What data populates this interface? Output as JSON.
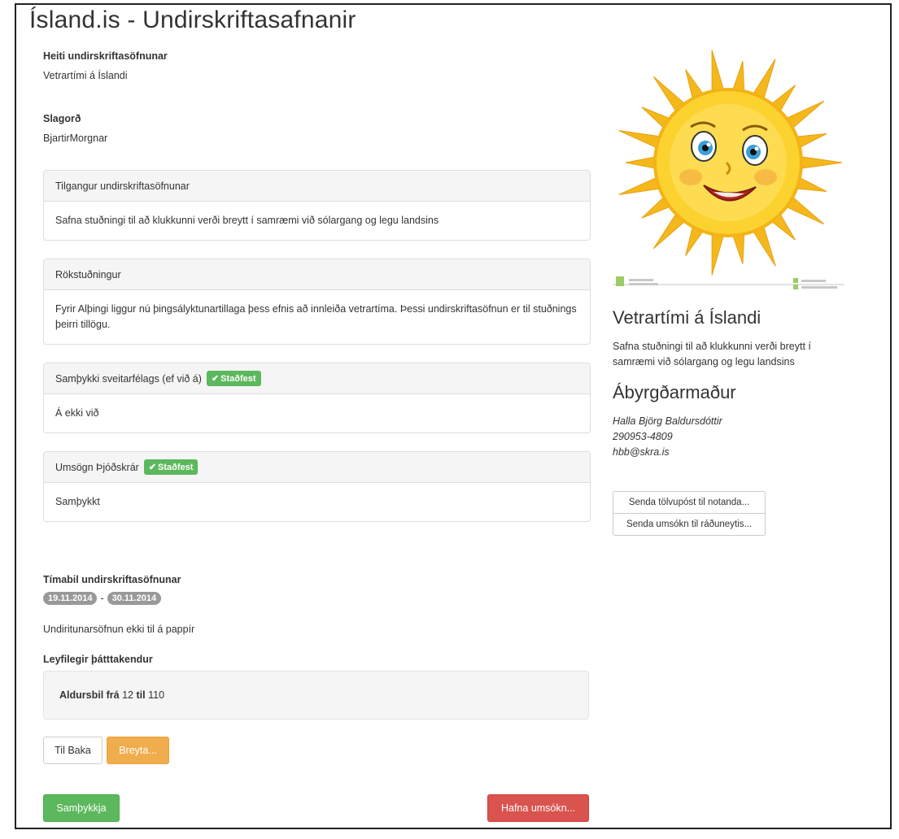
{
  "page": {
    "title": "Ísland.is - Undirskriftasafnanir"
  },
  "petition": {
    "name_label": "Heiti undirskriftasöfnunar",
    "name_value": "Vetrartími á Íslandi",
    "slogan_label": "Slagorð",
    "slogan_value": "BjartirMorgnar"
  },
  "panels": {
    "purpose": {
      "heading": "Tilgangur undirskriftasöfnunar",
      "body": "Safna stuðningi til að klukkunni verði breytt í samræmi við sólargang og legu landsins"
    },
    "reasoning": {
      "heading": "Rökstuðningur",
      "body": "Fyrir Alþingi liggur nú þingsályktunartillaga þess efnis að innleiða vetrartíma. Þessi undirskriftasöfnun er til stuðnings þeirri tillögu."
    },
    "municipality": {
      "heading": "Samþykki sveitarfélags (ef við á)",
      "badge": "Staðfest",
      "body": "Á ekki við"
    },
    "registry": {
      "heading": "Umsögn Þjóðskrár",
      "badge": "Staðfest",
      "body": "Samþykkt"
    }
  },
  "period": {
    "label": "Tímabil undirskriftasöfnunar",
    "start": "19.11.2014",
    "separator": "-",
    "end": "30.11.2014",
    "paper_note": "Undiritunarsöfnun ekki til á pappír"
  },
  "participants": {
    "label": "Leyfilegir þátttakendur",
    "age_prefix": "Aldursbil frá",
    "age_from": "12",
    "age_mid": "til",
    "age_to": "110"
  },
  "buttons": {
    "back": "Til Baka",
    "edit": "Breyta...",
    "approve": "Samþykkja",
    "reject": "Hafna umsókn..."
  },
  "sidebar": {
    "title": "Vetrartími á Íslandi",
    "description": "Safna stuðningi til að klukkunni verði breytt í samræmi við sólargang og legu landsins",
    "responsible_heading": "Ábyrgðarmaður",
    "contact_name": "Halla Björg Baldursdóttir",
    "contact_id": "290953-4809",
    "contact_email": "hbb@skra.is",
    "email_button": "Senda tölvupóst til notanda...",
    "ministry_button": "Senda umsókn til ráðuneytis..."
  },
  "colors": {
    "success": "#5cb85c",
    "warning": "#f0ad4e",
    "danger": "#d9534f",
    "pill": "#999999",
    "sun": "#f7c21a"
  }
}
